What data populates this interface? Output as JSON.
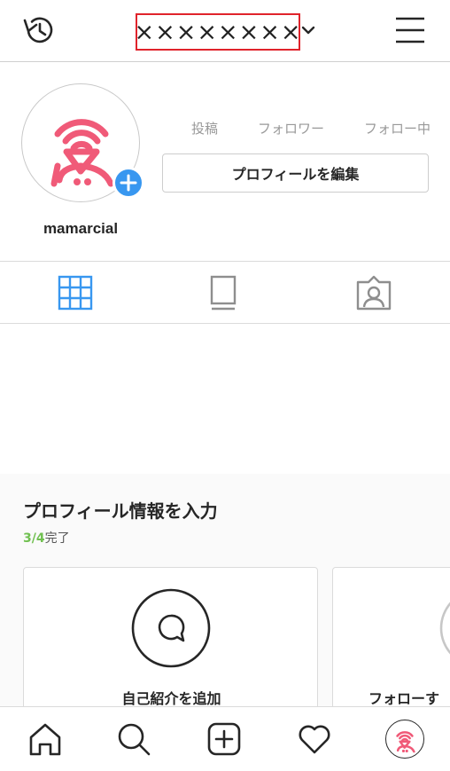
{
  "header": {
    "account_name": "××××××××",
    "history_icon": "history-icon",
    "dropdown_icon": "chevron-down-icon",
    "menu_icon": "hamburger-menu-icon",
    "highlight_color": "#e0232b"
  },
  "profile": {
    "username": "mamarcial",
    "avatar_icon": "wifi-person-logo",
    "add_story_icon": "plus-icon",
    "stats": {
      "posts_label": "投稿",
      "followers_label": "フォロワー",
      "following_label": "フォロー中"
    },
    "edit_button_label": "プロフィールを編集"
  },
  "tabs": [
    {
      "name": "grid",
      "icon": "grid-icon",
      "active": true
    },
    {
      "name": "igtv",
      "icon": "portrait-feed-icon",
      "active": false
    },
    {
      "name": "tagged",
      "icon": "tagged-person-icon",
      "active": false
    }
  ],
  "onboarding": {
    "title": "プロフィール情報を入力",
    "progress_done": "3/4",
    "progress_suffix": "完了",
    "cards": [
      {
        "label": "自己紹介を追加",
        "icon": "speech-bubble-icon"
      },
      {
        "label": "フォローす",
        "icon": "person-icon"
      }
    ]
  },
  "bottom_nav": [
    {
      "name": "home",
      "icon": "home-icon"
    },
    {
      "name": "search",
      "icon": "search-icon"
    },
    {
      "name": "new-post",
      "icon": "add-post-icon"
    },
    {
      "name": "activity",
      "icon": "heart-icon"
    },
    {
      "name": "profile",
      "icon": "profile-avatar-icon"
    }
  ],
  "colors": {
    "accent_blue": "#3897f0",
    "logo_pink": "#f05a78",
    "progress_green": "#70c050"
  }
}
